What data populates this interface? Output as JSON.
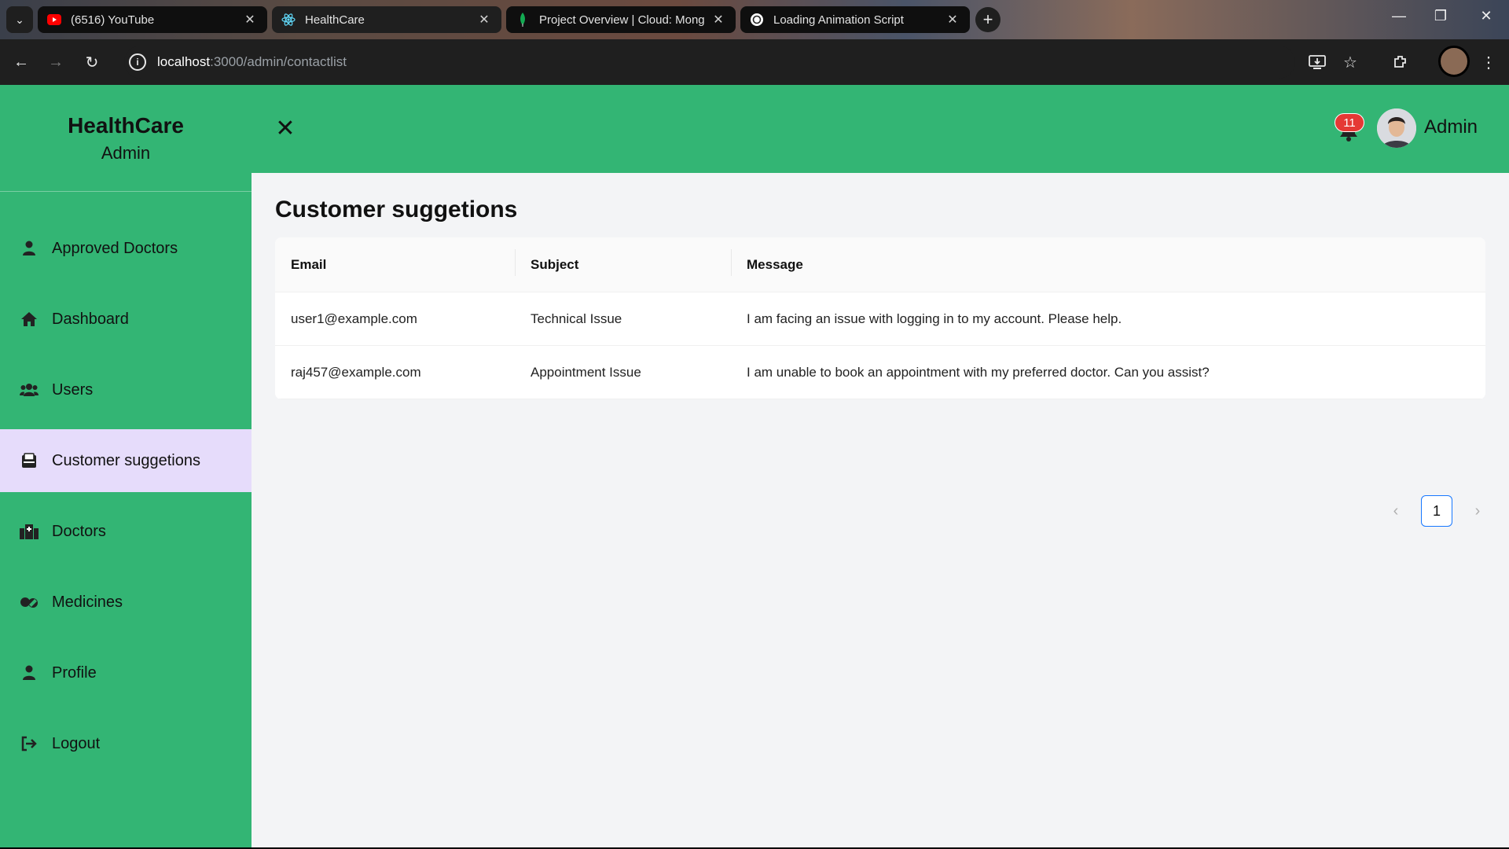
{
  "browser": {
    "tabs": [
      {
        "title": "(6516) YouTube",
        "icon": "youtube-icon",
        "active": false
      },
      {
        "title": "HealthCare",
        "icon": "react-icon",
        "active": true
      },
      {
        "title": "Project Overview | Cloud: Mong",
        "icon": "mongodb-leaf-icon",
        "active": false
      },
      {
        "title": "Loading Animation Script",
        "icon": "chatgpt-icon",
        "active": false
      }
    ],
    "url_host": "localhost",
    "url_path": ":3000/admin/contactlist"
  },
  "sidebar": {
    "brand": "HealthCare",
    "role": "Admin",
    "items": [
      {
        "label": "Approved Doctors",
        "icon": "user-icon"
      },
      {
        "label": "Dashboard",
        "icon": "home-icon"
      },
      {
        "label": "Users",
        "icon": "users-icon"
      },
      {
        "label": "Customer suggetions",
        "icon": "inbox-icon",
        "active": true
      },
      {
        "label": "Doctors",
        "icon": "hospital-icon"
      },
      {
        "label": "Medicines",
        "icon": "pills-icon"
      },
      {
        "label": "Profile",
        "icon": "user-icon"
      },
      {
        "label": "Logout",
        "icon": "logout-icon"
      }
    ]
  },
  "header": {
    "notification_count": "11",
    "user_name": "Admin"
  },
  "main": {
    "title": "Customer suggetions",
    "columns": [
      "Email",
      "Subject",
      "Message"
    ],
    "rows": [
      {
        "email": "user1@example.com",
        "subject": "Technical Issue",
        "message": "I am facing an issue with logging in to my account. Please help."
      },
      {
        "email": "raj457@example.com",
        "subject": "Appointment Issue",
        "message": "I am unable to book an appointment with my preferred doctor. Can you assist?"
      }
    ],
    "pagination": {
      "current_page": "1"
    }
  },
  "colors": {
    "brand_green": "#33b574",
    "active_menu": "#e6dcfb",
    "badge_red": "#e53935",
    "pager_blue": "#1677ff"
  }
}
